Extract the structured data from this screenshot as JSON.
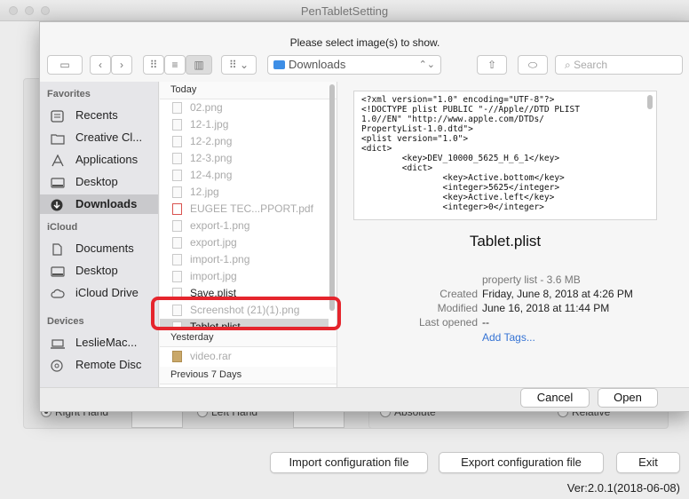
{
  "window": {
    "title": "PenTabletSetting",
    "buttons": {
      "import_label": "Import configuration file",
      "export_label": "Export configuration file",
      "exit_label": "Exit"
    },
    "background": {
      "right_hand": "Right Hand",
      "left_hand": "Left Hand",
      "absolute": "Absolute",
      "relative": "Relative"
    },
    "version": "Ver:2.0.1(2018-06-08)"
  },
  "dialog": {
    "message": "Please select image(s) to show.",
    "location": "Downloads",
    "search_placeholder": "Search",
    "sidebar": {
      "favorites_header": "Favorites",
      "favorites": [
        {
          "label": "Recents",
          "icon": "recents-icon"
        },
        {
          "label": "Creative Cl...",
          "icon": "folder-icon"
        },
        {
          "label": "Applications",
          "icon": "applications-icon"
        },
        {
          "label": "Desktop",
          "icon": "desktop-icon"
        },
        {
          "label": "Downloads",
          "icon": "downloads-icon"
        }
      ],
      "icloud_header": "iCloud",
      "icloud": [
        {
          "label": "Documents",
          "icon": "document-icon"
        },
        {
          "label": "Desktop",
          "icon": "desktop-icon"
        },
        {
          "label": "iCloud Drive",
          "icon": "cloud-icon"
        }
      ],
      "devices_header": "Devices",
      "devices": [
        {
          "label": "LeslieMac...",
          "icon": "laptop-icon"
        },
        {
          "label": "Remote Disc",
          "icon": "disc-icon"
        }
      ]
    },
    "files": {
      "today_header": "Today",
      "today": [
        "02.png",
        "12-1.jpg",
        "12-2.png",
        "12-3.png",
        "12-4.png",
        "12.jpg",
        "EUGEE TEC...PPORT.pdf",
        "export-1.png",
        "export.jpg",
        "import-1.png",
        "import.jpg",
        "Save.plist",
        "Screenshot (21)(1).png",
        "Tablet.plist"
      ],
      "yesterday_header": "Yesterday",
      "yesterday": [
        "video.rar"
      ],
      "previous_header": "Previous 7 Days"
    },
    "preview": {
      "code": [
        "<?xml version=\"1.0\" encoding=\"UTF-8\"?>",
        "<!DOCTYPE plist PUBLIC \"-//Apple//DTD PLIST",
        "1.0//EN\" \"http://www.apple.com/DTDs/",
        "PropertyList-1.0.dtd\">",
        "<plist version=\"1.0\">",
        "<dict>",
        "        <key>DEV_10000_5625_H_6_1</key>",
        "        <dict>",
        "                <key>Active.bottom</key>",
        "                <integer>5625</integer>",
        "                <key>Active.left</key>",
        "                <integer>0</integer>"
      ],
      "name": "Tablet.plist",
      "kind": "property list - 3.6 MB",
      "created_label": "Created",
      "created": "Friday, June 8, 2018 at 4:26 PM",
      "modified_label": "Modified",
      "modified": "June 16, 2018 at 11:44 PM",
      "last_opened_label": "Last opened",
      "last_opened": "--",
      "add_tags": "Add Tags..."
    },
    "cancel_label": "Cancel",
    "open_label": "Open"
  },
  "colors": {
    "highlight": "#e5252d",
    "link": "#3573d4",
    "folder": "#3d8ee6"
  }
}
